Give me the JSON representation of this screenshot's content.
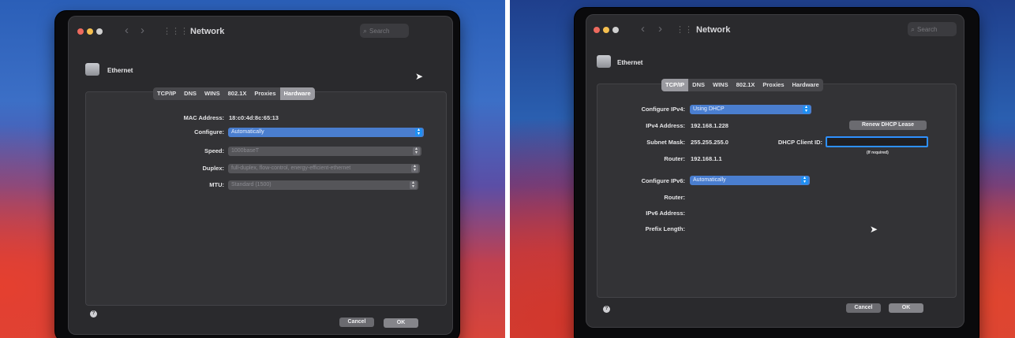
{
  "left": {
    "window_title": "Network",
    "search_placeholder": "Search",
    "interface_name": "Ethernet",
    "tabs": [
      "TCP/IP",
      "DNS",
      "WINS",
      "802.1X",
      "Proxies",
      "Hardware"
    ],
    "active_tab": "Hardware",
    "mac_label": "MAC Address:",
    "mac_value": "18:c0:4d:8c:65:13",
    "configure_label": "Configure:",
    "configure_value": "Automatically",
    "speed_label": "Speed:",
    "speed_value": "1000baseT",
    "duplex_label": "Duplex:",
    "duplex_value": "full-duplex, flow-control, energy-efficient-ethernet",
    "mtu_label": "MTU:",
    "mtu_value": "Standard (1500)",
    "cancel": "Cancel",
    "ok": "OK"
  },
  "right": {
    "window_title": "Network",
    "search_placeholder": "Search",
    "interface_name": "Ethernet",
    "tabs": [
      "TCP/IP",
      "DNS",
      "WINS",
      "802.1X",
      "Proxies",
      "Hardware"
    ],
    "active_tab": "TCP/IP",
    "configure_ipv4_label": "Configure IPv4:",
    "configure_ipv4_value": "Using DHCP",
    "ipv4_address_label": "IPv4 Address:",
    "ipv4_address_value": "192.168.1.228",
    "renew_button": "Renew DHCP Lease",
    "subnet_label": "Subnet Mask:",
    "subnet_value": "255.255.255.0",
    "dhcp_client_id_label": "DHCP Client ID:",
    "dhcp_client_id_value": "",
    "if_required": "(If required)",
    "router_label": "Router:",
    "router_value": "192.168.1.1",
    "configure_ipv6_label": "Configure IPv6:",
    "configure_ipv6_value": "Automatically",
    "router6_label": "Router:",
    "ipv6_address_label": "IPv6 Address:",
    "prefix_length_label": "Prefix Length:",
    "cancel": "Cancel",
    "ok": "OK"
  },
  "colors": {
    "window_bg": "#2a2a2d",
    "accent_blue": "#4a7ecf",
    "focus_ring": "#2e90ff",
    "traffic_red": "#ee6a5e",
    "traffic_yellow": "#f5bf4f",
    "traffic_green": "#d0d0d0"
  }
}
